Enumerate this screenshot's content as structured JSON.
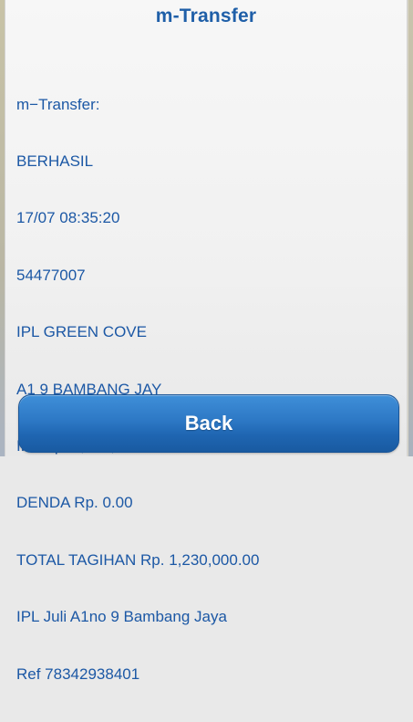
{
  "dialog": {
    "title": "m-Transfer",
    "message_lines": [
      "m−Transfer:",
      "BERHASIL",
      "17/07 08:35:20",
      "54477007",
      "IPL GREEN COVE",
      "A1 9 BAMBANG JAY",
      "IPL Rp. 1,230,000.00",
      "DENDA Rp. 0.00",
      "TOTAL TAGIHAN Rp. 1,230,000.00",
      "IPL Juli A1no 9 Bambang Jaya",
      "Ref 78342938401"
    ],
    "back_label": "Back"
  },
  "colors": {
    "title": "#1f5fa8",
    "text": "#1c58a5",
    "button": "#2d78c5",
    "button_text": "#ffffff"
  }
}
